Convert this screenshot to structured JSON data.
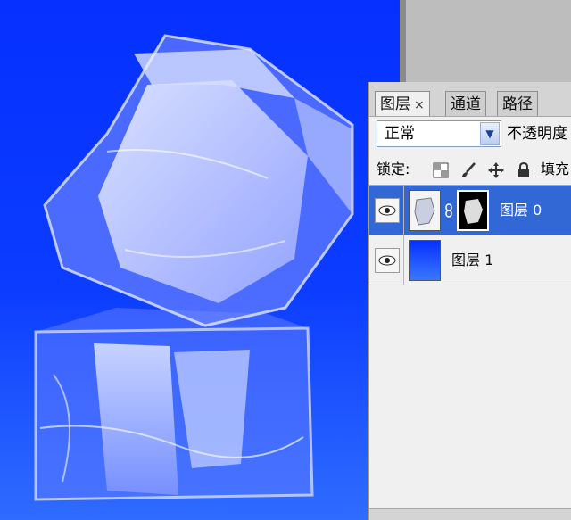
{
  "colors": {
    "canvas_blue": "#0b3cff",
    "selection": "#3168d6",
    "panel_bg": "#f0f0f0"
  },
  "tabs": [
    {
      "label": "图层",
      "close": "×",
      "active": true
    },
    {
      "label": "通道",
      "active": false
    },
    {
      "label": "路径",
      "active": false
    }
  ],
  "blend_mode": {
    "value": "正常",
    "icon": "chevron-down-icon"
  },
  "opacity_label": "不透明度",
  "lock_label": "锁定:",
  "lock_icons": [
    "transparency-lock-icon",
    "brush-lock-icon",
    "move-lock-icon",
    "padlock-icon"
  ],
  "fill_label": "填充",
  "layers": [
    {
      "name": "图层 0",
      "selected": true,
      "visible": true,
      "has_mask": true,
      "link_icon": "chain-link-icon"
    },
    {
      "name": "图层 1",
      "selected": false,
      "visible": true,
      "has_mask": false
    }
  ]
}
